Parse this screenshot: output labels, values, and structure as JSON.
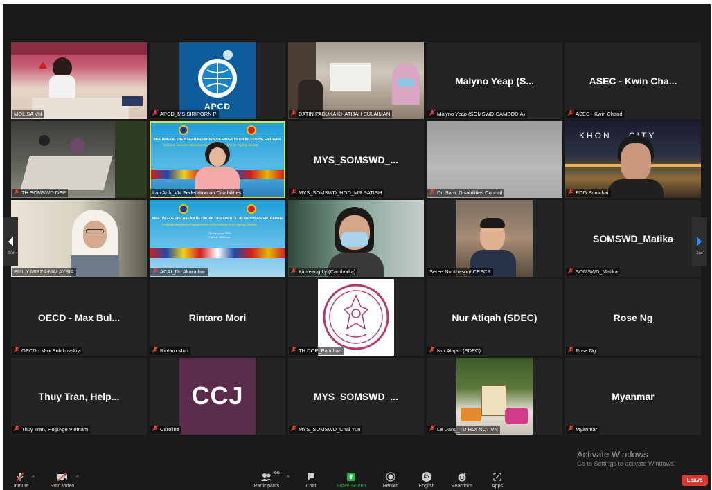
{
  "gallery": {
    "tiles": [
      {
        "name": "MOLISA-VN",
        "label": "MOLISA VN",
        "display": ""
      },
      {
        "name": "APCD",
        "label": "APCD_MS SIRIPORN P",
        "display": ""
      },
      {
        "name": "DATIN",
        "label": "DATIN PADUKA KHATIJAH SULAIMAN",
        "display": ""
      },
      {
        "name": "Malyno",
        "label": "Malyno Yeap (SOMSWD-CAMBODIA)",
        "display": "Malyno Yeap (S..."
      },
      {
        "name": "ASEC",
        "label": "ASEC - Kwin Chand",
        "display": "ASEC - Kwin Cha..."
      },
      {
        "name": "TH-SOMSWD",
        "label": "TH SOMSWD DEP",
        "display": ""
      },
      {
        "name": "LanAnh",
        "label": "Lan Anh_VN Federation on Disabilities",
        "display": ""
      },
      {
        "name": "MYS-HOD",
        "label": "MYS_SOMSWD_HOD_MR SATISH",
        "display": "MYS_SOMSWD_..."
      },
      {
        "name": "DrSam",
        "label": "Dr. Sam. Disabilities Council",
        "display": ""
      },
      {
        "name": "PDG",
        "label": "PDG.Somchai",
        "display": ""
      },
      {
        "name": "Emily",
        "label": "EMILY MIRZA-MALAYSIA",
        "display": ""
      },
      {
        "name": "ACAI",
        "label": "ACAI_Dr. Akarathan",
        "display": ""
      },
      {
        "name": "Kimleang",
        "label": "Kimleang Ly (Cambodia)",
        "display": ""
      },
      {
        "name": "Seree",
        "label": "Seree Nonthasoot CESCR",
        "display": ""
      },
      {
        "name": "Matika",
        "label": "SOMSWD_Matika",
        "display": "SOMSWD_Matika"
      },
      {
        "name": "OECD",
        "label": "OECD - Max Bulakovskiy",
        "display": "OECD - Max Bul..."
      },
      {
        "name": "Rintaro",
        "label": "Rintaro Mori",
        "display": "Rintaro Mori"
      },
      {
        "name": "THDOP",
        "label": "TH DOP_Panithan",
        "display": ""
      },
      {
        "name": "NurAtiqah",
        "label": "Nur Atiqah (SDEC)",
        "display": "Nur Atiqah (SDEC)"
      },
      {
        "name": "RoseNg",
        "label": "Rose Ng",
        "display": "Rose Ng"
      },
      {
        "name": "Thuy",
        "label": "Thuy Tran, HelpAge Vietnam",
        "display": "Thuy Tran, Help..."
      },
      {
        "name": "Caroline",
        "label": "Caroline",
        "display": ""
      },
      {
        "name": "MYS-Chai",
        "label": "MYS_SOMSWD_Chai Yun",
        "display": "MYS_SOMSWD_..."
      },
      {
        "name": "LeDang",
        "label": "Le Dang_TU HOI NCT VN",
        "display": ""
      },
      {
        "name": "Myanmar",
        "label": "Myanmar",
        "display": "Myanmar"
      }
    ],
    "apcd_logo_text": "APCD",
    "ccj_logo_text": "CCJ",
    "khon_city_text": "KHON    CITY",
    "banner_title": "MEETING OF THE ASEAN NETWORK OF EXPERTS ON INCLUSIVE ENTREPRENEURSHIP FOR ASEAN (NIEA)",
    "banner_subtitle": "Inclusive Business Empowerment of the Elderly in an Ageing Society",
    "banner_date": "24 November 2021",
    "banner_place": "Ha Noi, Viet Nam",
    "page_left": "1/3",
    "page_right": "1/3"
  },
  "watermark": {
    "title": "Activate Windows",
    "subtitle": "Go to Settings to activate Windows."
  },
  "toolbar": {
    "unmute": "Unmute",
    "start_video": "Start Video",
    "participants": "Participants",
    "participants_count": "66",
    "chat": "Chat",
    "share_screen": "Share Screen",
    "record": "Record",
    "english": "English",
    "english_badge": "EN",
    "reactions": "Reactions",
    "apps": "Apps",
    "leave": "Leave"
  },
  "colors": {
    "active_speaker": "#d6e14a",
    "share_green": "#23b245",
    "leave_red": "#d83a32",
    "mute_red": "#e5493a"
  }
}
